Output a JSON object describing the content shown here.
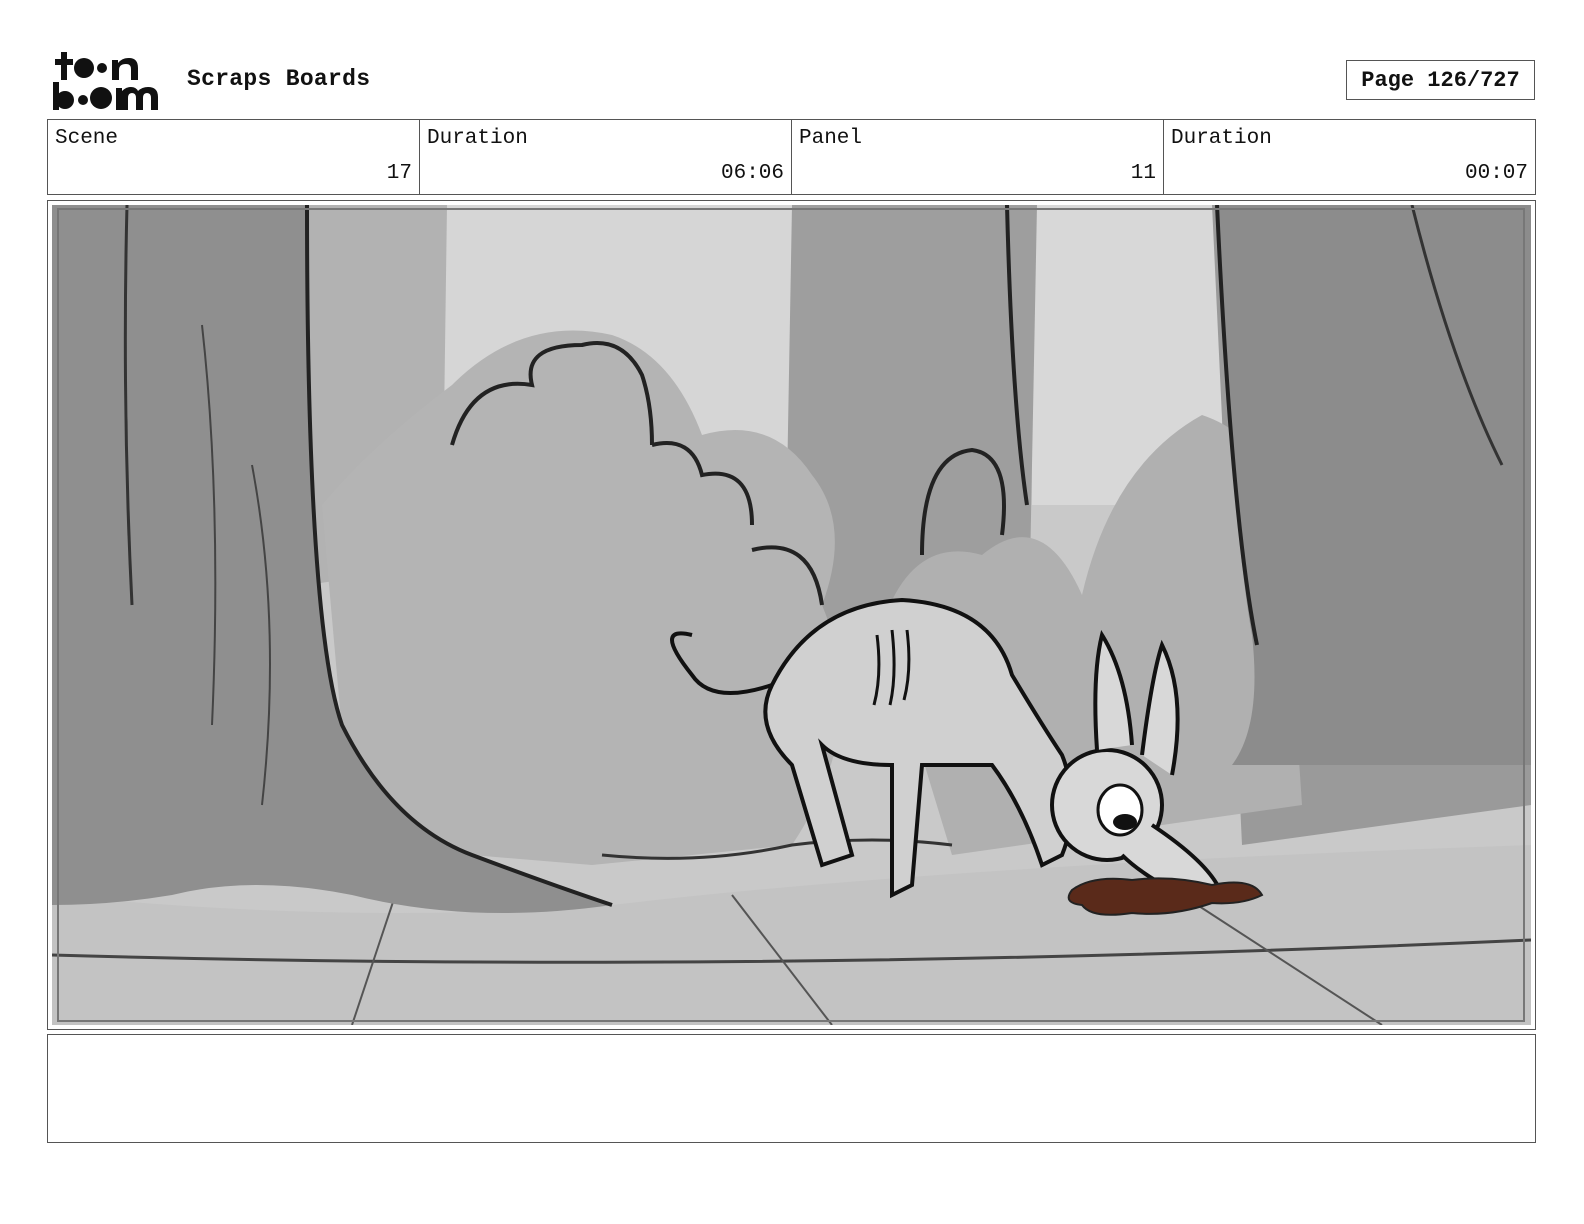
{
  "header": {
    "logo_text": "toon boom",
    "title": "Scraps Boards",
    "page_label": "Page 126/727"
  },
  "info": {
    "scene_label": "Scene",
    "scene_value": "17",
    "scene_duration_label": "Duration",
    "scene_duration_value": "06:06",
    "panel_label": "Panel",
    "panel_value": "11",
    "panel_duration_label": "Duration",
    "panel_duration_value": "00:07"
  },
  "notes": {
    "text": ""
  }
}
